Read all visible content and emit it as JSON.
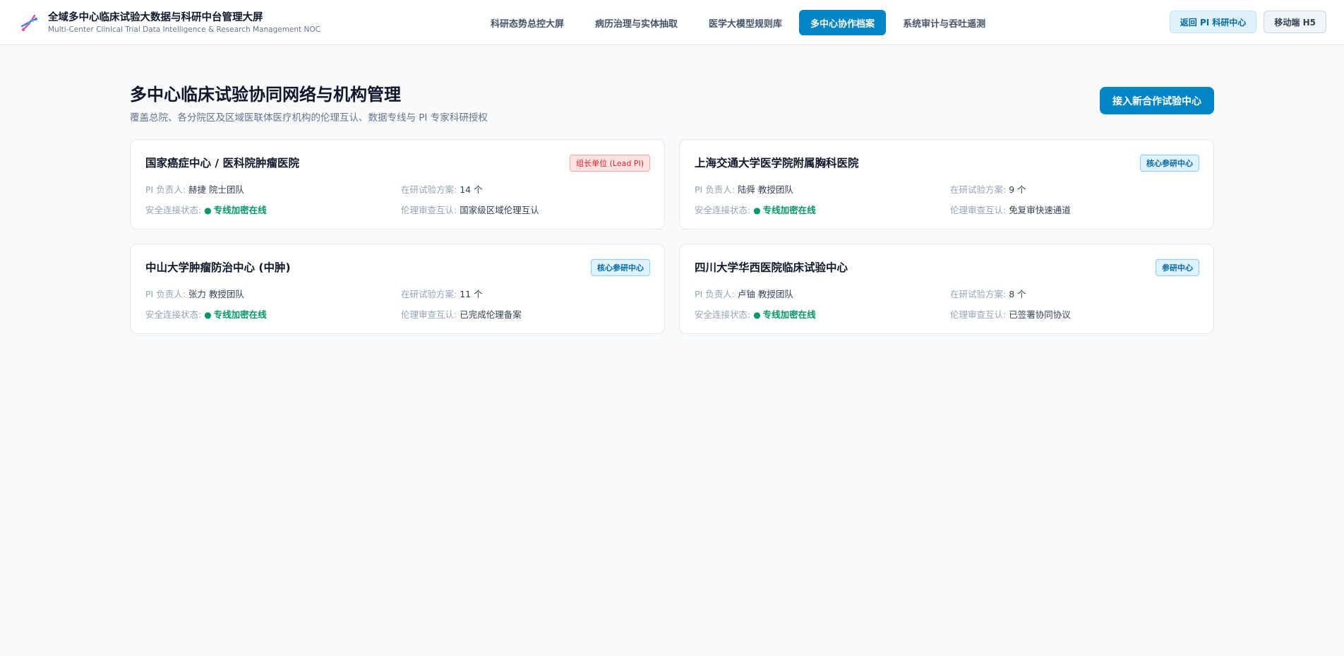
{
  "app": {
    "title": "全域多中心临床试验大数据与科研中台管理大屏",
    "subtitle": "Multi-Center Clinical Trial Data Intelligence & Research Management NOC",
    "logo_icon": "dna-helix-icon"
  },
  "nav": {
    "tabs": [
      {
        "label": "科研态势总控大屏",
        "active": false
      },
      {
        "label": "病历治理与实体抽取",
        "active": false
      },
      {
        "label": "医学大模型规则库",
        "active": false
      },
      {
        "label": "多中心协作档案",
        "active": true
      },
      {
        "label": "系统审计与吞吐遥测",
        "active": false
      }
    ]
  },
  "actions": {
    "return_label": "返回 PI 科研中心",
    "mobile_label": "移动端 H5"
  },
  "page": {
    "title": "多中心临床试验协同网络与机构管理",
    "subtitle": "覆盖总院、各分院区及区域医联体医疗机构的伦理互认、数据专线与 PI 专家科研授权",
    "connect_label": "接入新合作试验中心"
  },
  "labels": {
    "pi": "PI 负责人: ",
    "trials": "在研试验方案: ",
    "connection": "安全连接状态: ",
    "ethics": "伦理审查互认: "
  },
  "colors": {
    "accent": "#0284c7",
    "online": "#059669",
    "lead_badge": "#dc2626"
  },
  "centers": [
    {
      "name": "国家癌症中心 / 医科院肿瘤医院",
      "badge": "组长单位 (Lead PI)",
      "badge_type": "lead",
      "pi": "赫捷 院士团队",
      "trials": "14 个",
      "connection": "专线加密在线",
      "ethics": "国家级区域伦理互认"
    },
    {
      "name": "上海交通大学医学院附属胸科医院",
      "badge": "核心参研中心",
      "badge_type": "core",
      "pi": "陆舜 教授团队",
      "trials": "9 个",
      "connection": "专线加密在线",
      "ethics": "免复审快速通道"
    },
    {
      "name": "中山大学肿瘤防治中心 (中肿)",
      "badge": "核心参研中心",
      "badge_type": "core",
      "pi": "张力 教授团队",
      "trials": "11 个",
      "connection": "专线加密在线",
      "ethics": "已完成伦理备案"
    },
    {
      "name": "四川大学华西医院临床试验中心",
      "badge": "参研中心",
      "badge_type": "part",
      "pi": "卢铀 教授团队",
      "trials": "8 个",
      "connection": "专线加密在线",
      "ethics": "已签署协同协议"
    }
  ]
}
